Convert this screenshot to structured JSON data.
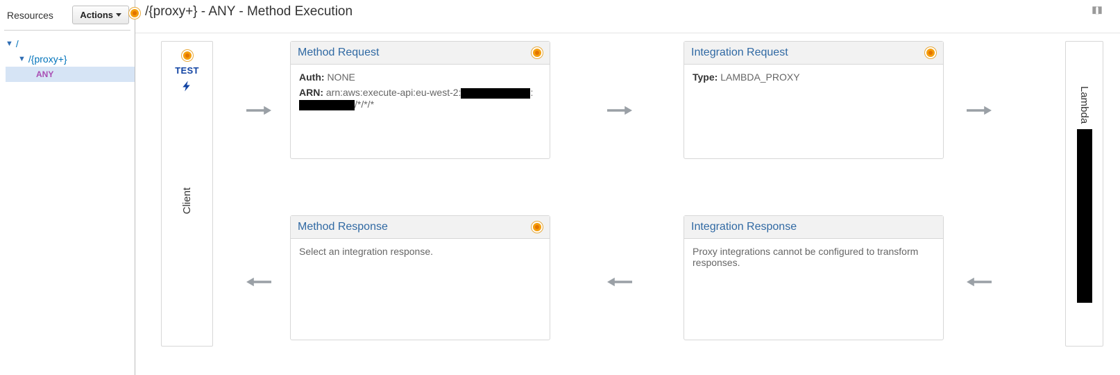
{
  "sidebar": {
    "title": "Resources",
    "actions_label": "Actions",
    "tree": {
      "root": "/",
      "proxy": "/{proxy+}",
      "method": "ANY"
    }
  },
  "header": {
    "breadcrumb": "/{proxy+} - ANY - Method Execution"
  },
  "client": {
    "test_label": "TEST",
    "label": "Client"
  },
  "lambda": {
    "label": "Lambda"
  },
  "method_request": {
    "title": "Method Request",
    "auth_label": "Auth:",
    "auth_value": "NONE",
    "arn_label": "ARN:",
    "arn_prefix": "arn:aws:execute-api:eu-west-2:",
    "arn_suffix": "/*/*/*"
  },
  "integration_request": {
    "title": "Integration Request",
    "type_label": "Type:",
    "type_value": "LAMBDA_PROXY"
  },
  "method_response": {
    "title": "Method Response",
    "body": "Select an integration response."
  },
  "integration_response": {
    "title": "Integration Response",
    "body": "Proxy integrations cannot be configured to transform responses."
  }
}
